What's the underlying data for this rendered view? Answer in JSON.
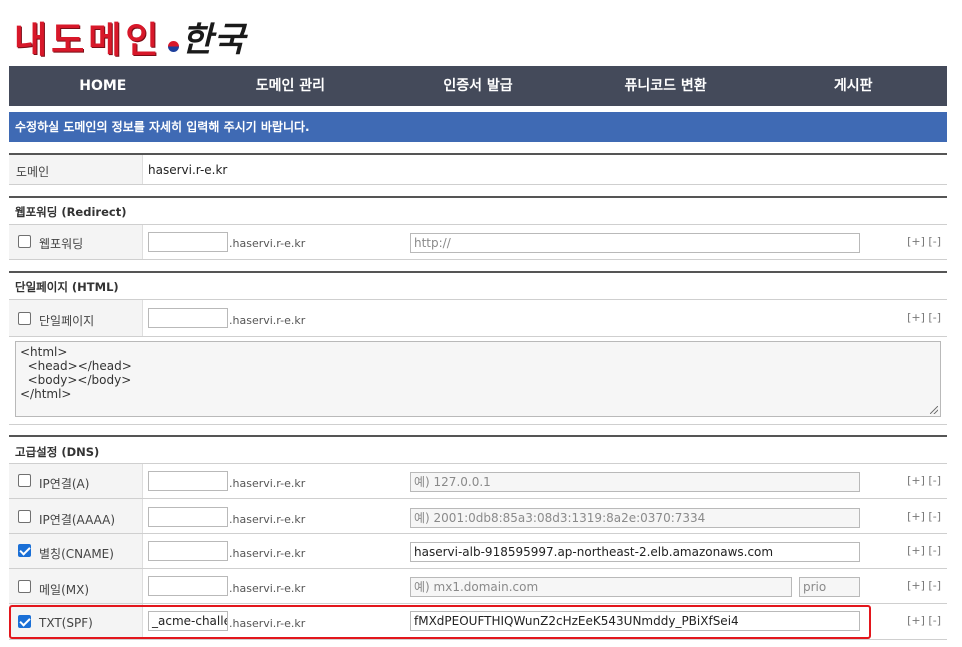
{
  "logo": {
    "main": "내도메인",
    "sub": "한국"
  },
  "nav": [
    "HOME",
    "도메인 관리",
    "인증서 발급",
    "퓨니코드 변환",
    "게시판"
  ],
  "notice": "수정하실 도메인의 정보를 자세히 입력해 주시기 바랍니다.",
  "domain_row": {
    "label": "도메인",
    "value": "haservi.r-e.kr"
  },
  "sections": {
    "redirect": "웹포워딩 (Redirect)",
    "html": "단일페이지 (HTML)",
    "dns": "고급설정 (DNS)"
  },
  "suffix": ".haservi.r-e.kr",
  "plusminus": "[+] [-]",
  "redirect": {
    "label": "웹포워딩",
    "checked": false,
    "sub": "",
    "url_placeholder": "http://"
  },
  "html": {
    "label": "단일페이지",
    "checked": false,
    "sub": "",
    "content": "<html>\n  <head></head>\n  <body></body>\n</html>"
  },
  "dns_records": [
    {
      "type": "A",
      "label": "IP연결(A)",
      "checked": false,
      "sub": "",
      "value": "",
      "placeholder": "예) 127.0.0.1"
    },
    {
      "type": "AAAA",
      "label": "IP연결(AAAA)",
      "checked": false,
      "sub": "",
      "value": "",
      "placeholder": "예) 2001:0db8:85a3:08d3:1319:8a2e:0370:7334"
    },
    {
      "type": "CNAME",
      "label": "별칭(CNAME)",
      "checked": true,
      "sub": "",
      "value": "haservi-alb-918595997.ap-northeast-2.elb.amazonaws.com",
      "placeholder": ""
    },
    {
      "type": "MX",
      "label": "메일(MX)",
      "checked": false,
      "sub": "",
      "value": "",
      "placeholder": "예) mx1.domain.com",
      "prio_placeholder": "prio"
    },
    {
      "type": "TXT",
      "label": "TXT(SPF)",
      "checked": true,
      "sub": "_acme-challenge",
      "value": "fMXdPEOUFTHIQWunZ2cHzEeK543UNmddy_PBiXfSei4",
      "placeholder": ""
    }
  ],
  "colors": {
    "nav_bg": "#444a5a",
    "notice_bg": "#3f6ab4",
    "logo_red": "#d8182a",
    "highlight": "#e3161c",
    "checkbox_on": "#1a6fd6"
  }
}
